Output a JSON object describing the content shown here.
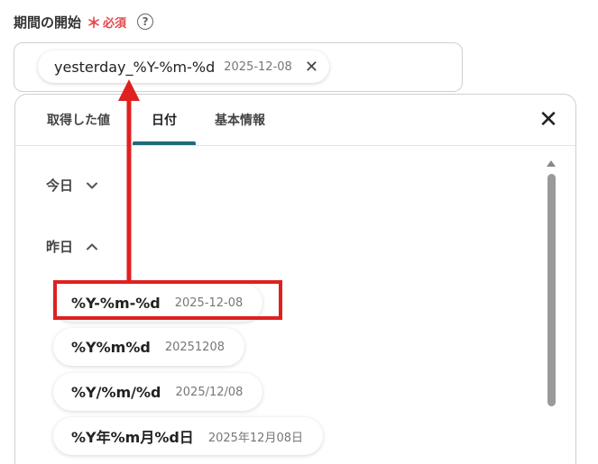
{
  "field": {
    "label": "期間の開始",
    "required_star": "＊",
    "required_text": "必須",
    "help": "?"
  },
  "selected_chip": {
    "value": "yesterday_%Y-%m-%d",
    "date": "2025-12-08",
    "remove": "✕"
  },
  "tabs": [
    {
      "label": "取得した値"
    },
    {
      "label": "日付"
    },
    {
      "label": "基本情報"
    }
  ],
  "active_tab": "日付",
  "close": "✕",
  "sections": [
    {
      "label": "今日",
      "state": "collapsed"
    },
    {
      "label": "昨日",
      "state": "expanded"
    }
  ],
  "options": [
    {
      "format": "%Y-%m-%d",
      "date": "2025-12-08"
    },
    {
      "format": "%Y%m%d",
      "date": "20251208"
    },
    {
      "format": "%Y/%m/%d",
      "date": "2025/12/08"
    },
    {
      "format": "%Y年%m月%d日",
      "date": "2025年12月08日"
    }
  ],
  "colors": {
    "required": "#e5484d",
    "active_tab_underline": "#1e6a7a",
    "annotation": "#e02020"
  }
}
